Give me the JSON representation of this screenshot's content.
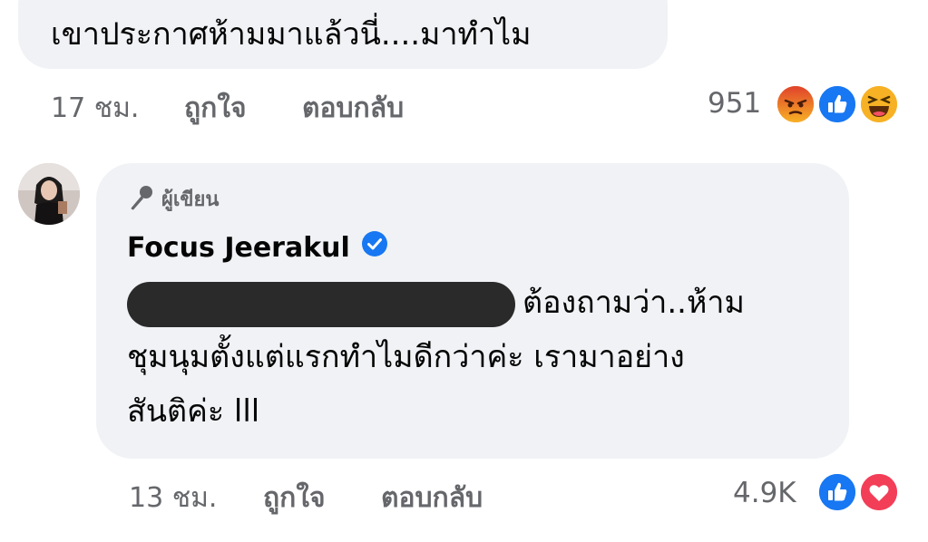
{
  "comment1": {
    "text": "เขาประกาศห้ามมาแล้วนี่....มาทำไม",
    "time": "17 ชม.",
    "like_label": "ถูกใจ",
    "reply_label": "ตอบกลับ",
    "reaction_count": "951",
    "reactions": [
      "angry-icon",
      "like-icon",
      "haha-icon"
    ]
  },
  "comment2": {
    "badge_label": "ผู้เขียน",
    "author": "Focus Jeerakul",
    "line1_tail": "ต้องถามว่า..ห้าม",
    "line2": "ชุมนุมตั้งแต่แรกทำไมดีกว่าค่ะ เรามาอย่าง",
    "line3": "สันติค่ะ lll",
    "time": "13 ชม.",
    "like_label": "ถูกใจ",
    "reply_label": "ตอบกลับ",
    "reaction_count": "4.9K",
    "reactions": [
      "like-icon",
      "love-icon"
    ]
  },
  "colors": {
    "bubble": "#f0f2f5",
    "meta_text": "#65676b",
    "like_blue": "#1877f2",
    "love_red": "#f33e58",
    "angry_orange": "#e9710f",
    "haha_yellow": "#f7b125"
  }
}
